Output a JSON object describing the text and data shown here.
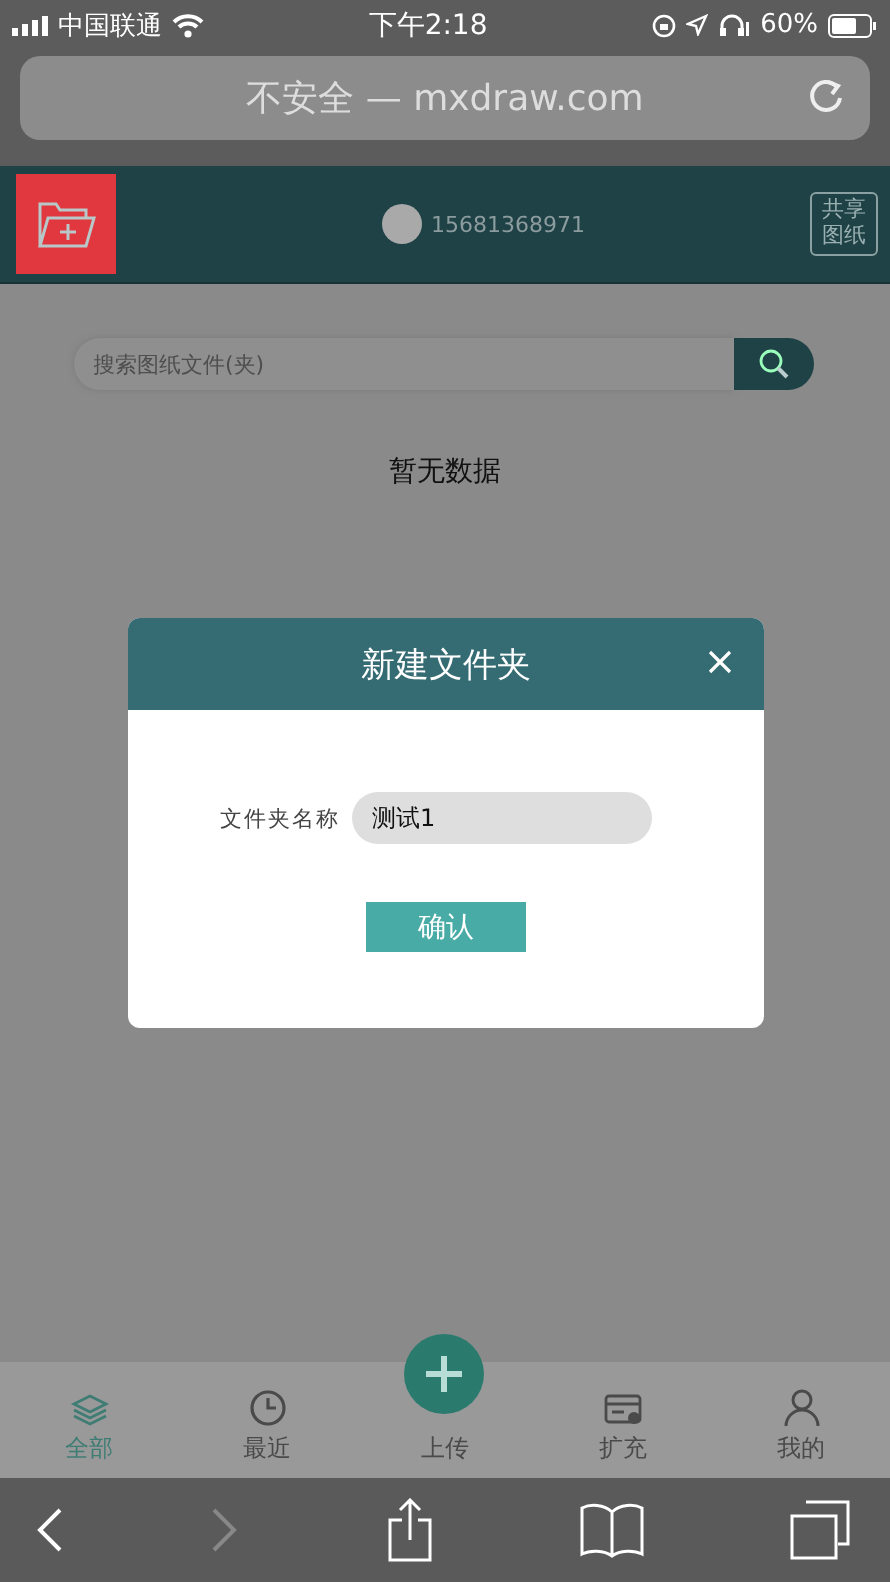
{
  "status_bar": {
    "carrier": "中国联通",
    "time": "下午2:18",
    "battery": "60%"
  },
  "browser": {
    "address": "不安全 — mxdraw.com",
    "forward_disabled": true
  },
  "header": {
    "phone": "15681368971",
    "share_button": "共享图纸"
  },
  "search": {
    "placeholder": "搜索图纸文件(夹)"
  },
  "empty_text": "暂无数据",
  "dialog": {
    "title": "新建文件夹",
    "field_label": "文件夹名称",
    "field_value": "测试1",
    "confirm": "确认"
  },
  "tabs": [
    {
      "kind": "layers",
      "label": "全部",
      "selected": true
    },
    {
      "kind": "clock",
      "label": "最近",
      "selected": false
    },
    {
      "kind": "upload",
      "label": "上传",
      "selected": false
    },
    {
      "kind": "card",
      "label": "扩充",
      "selected": false
    },
    {
      "kind": "person",
      "label": "我的",
      "selected": false
    }
  ]
}
